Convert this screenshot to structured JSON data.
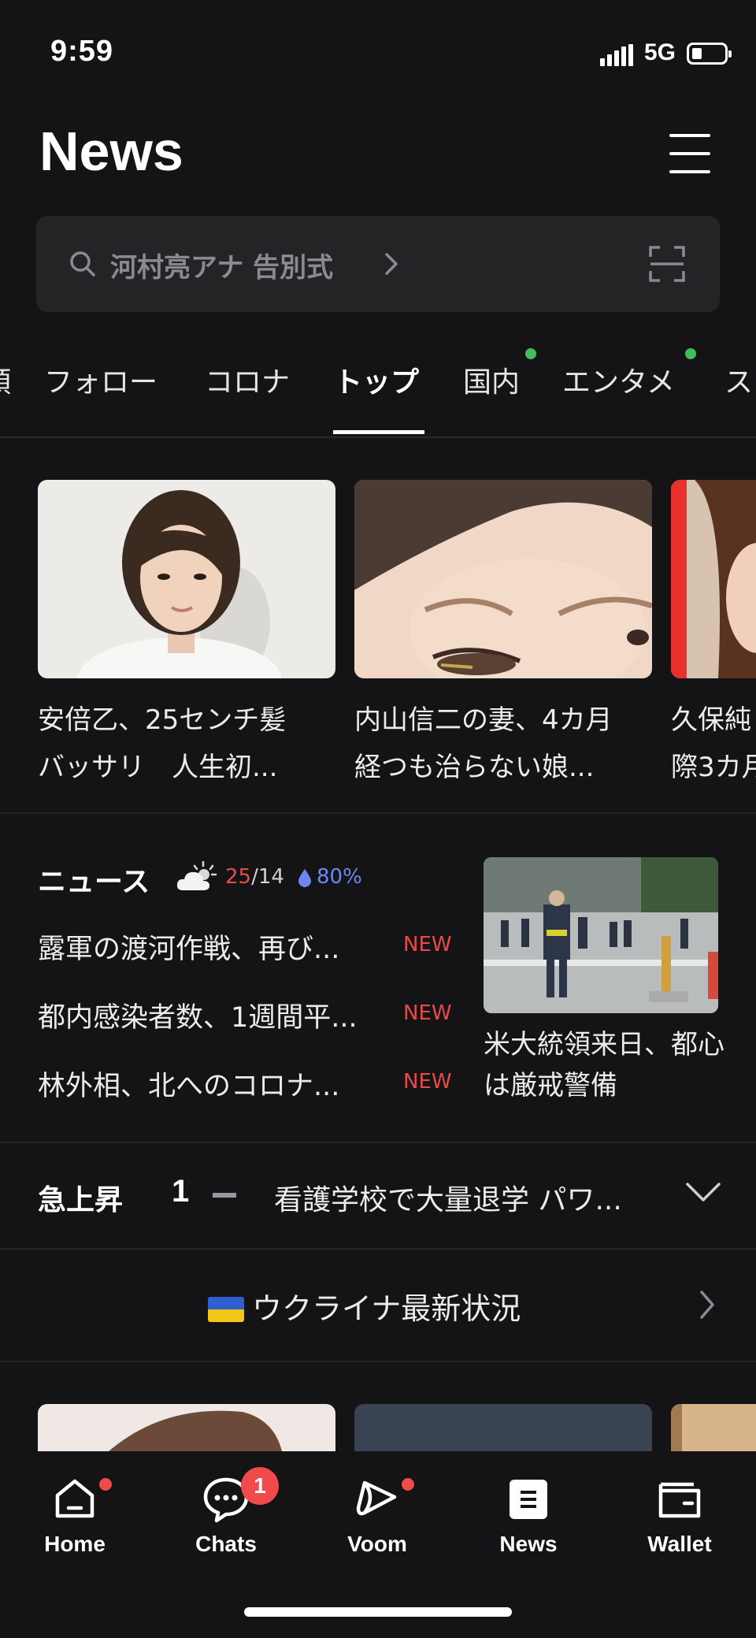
{
  "status_bar": {
    "time": "9:59",
    "network": "5G"
  },
  "header": {
    "title": "News"
  },
  "search": {
    "query": "河村亮アナ 告別式"
  },
  "tabs": [
    {
      "label": "頭",
      "active": false,
      "dot": false
    },
    {
      "label": "フォロー",
      "active": false,
      "dot": false
    },
    {
      "label": "コロナ",
      "active": false,
      "dot": false
    },
    {
      "label": "トップ",
      "active": true,
      "dot": false
    },
    {
      "label": "国内",
      "active": false,
      "dot": true
    },
    {
      "label": "エンタメ",
      "active": false,
      "dot": true
    },
    {
      "label": "ス",
      "active": false,
      "dot": false
    }
  ],
  "top_cards": [
    {
      "line1": "安倍乙、25センチ髪",
      "line2": "バッサリ　人生初..."
    },
    {
      "line1": "内山信二の妻、4カ月",
      "line2": "経つも治らない娘..."
    },
    {
      "line1": "久保純",
      "line2": "際3カ月"
    }
  ],
  "news_section": {
    "title": "ニュース",
    "weather": {
      "icon": "partly-cloudy-icon",
      "high": "25",
      "low": "/14",
      "rain": "80%"
    },
    "headlines": [
      {
        "text": "露軍の渡河作戦、再び...",
        "badge": "NEW"
      },
      {
        "text": "都内感染者数、1週間平...",
        "badge": "NEW"
      },
      {
        "text": "林外相、北へのコロナ...",
        "badge": "NEW"
      }
    ],
    "feature_caption": "米大統領来日、都心は厳戒警備"
  },
  "rising": {
    "label": "急上昇",
    "rank": "1",
    "text": "看護学校で大量退学 パワ..."
  },
  "ukraine": {
    "label": "ウクライナ最新状況"
  },
  "nav": [
    {
      "label": "Home",
      "icon": "home-icon"
    },
    {
      "label": "Chats",
      "icon": "chat-icon",
      "badge": "1"
    },
    {
      "label": "Voom",
      "icon": "voom-icon"
    },
    {
      "label": "News",
      "icon": "news-icon"
    },
    {
      "label": "Wallet",
      "icon": "wallet-icon"
    }
  ],
  "colors": {
    "background": "#141416",
    "accent_red": "#e84a4a",
    "green_dot": "#3fbf5a",
    "rain_blue": "#6f86f0"
  }
}
